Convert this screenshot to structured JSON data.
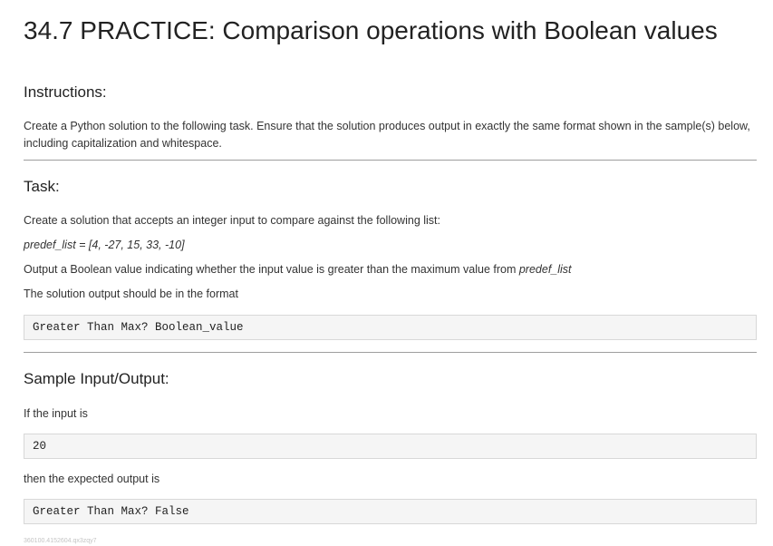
{
  "title": "34.7 PRACTICE: Comparison operations with Boolean values",
  "instructions": {
    "heading": "Instructions:",
    "text": "Create a Python solution to the following task. Ensure that the solution produces output in exactly the same format shown in the sample(s) below, including capitalization and whitespace."
  },
  "task": {
    "heading": "Task:",
    "line1": "Create a solution that accepts an integer input to compare against the following list:",
    "list_definition": "predef_list = [4, -27, 15, 33, -10]",
    "line3_prefix": "Output a Boolean value indicating whether the input value is greater than the maximum value from ",
    "line3_var": "predef_list",
    "line4": "The solution output should be in the format",
    "format_code": "Greater Than Max? Boolean_value"
  },
  "sample": {
    "heading": "Sample Input/Output:",
    "input_label": "If the input is",
    "input_code": "20",
    "output_label": "then the expected output is",
    "output_code": "Greater Than Max? False"
  },
  "footer_id": "360100.4152604.qx3zqy7"
}
